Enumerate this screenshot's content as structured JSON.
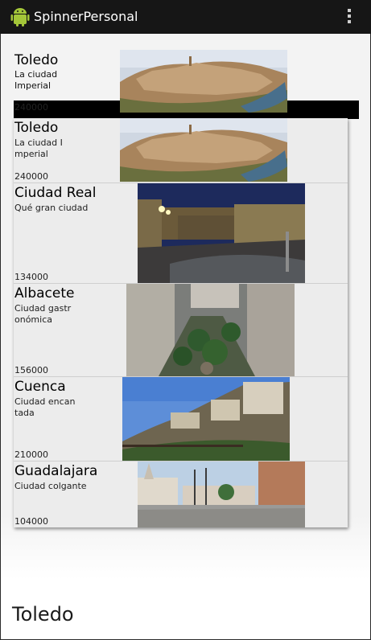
{
  "app": {
    "title": "SpinnerPersonal"
  },
  "spinner_selected": {
    "name": "Toledo",
    "desc": "La ciudad Imperial",
    "population": "240000"
  },
  "items": [
    {
      "name": "Toledo",
      "desc": "La ciudad Imperial",
      "population": "240000"
    },
    {
      "name": "Ciudad Real",
      "desc": "Qué gran ciudad",
      "population": "134000"
    },
    {
      "name": "Albacete",
      "desc": "Ciudad gastronómica",
      "population": "156000"
    },
    {
      "name": "Cuenca",
      "desc": "Ciudad encantada",
      "population": "210000"
    },
    {
      "name": "Guadalajara",
      "desc": "Ciudad colgante",
      "population": "104000"
    }
  ],
  "footer": {
    "selected_text": "Toledo"
  }
}
